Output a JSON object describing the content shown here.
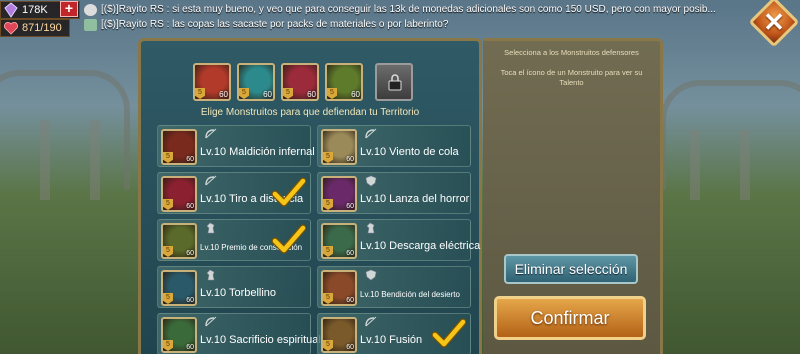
{
  "resources": {
    "gems": "178K",
    "health": "871/190",
    "add_label": "+"
  },
  "chat": [
    {
      "text": "[($)]Rayito RS : si esta muy bueno, y veo que para conseguir las 13k de monedas adicionales son como 150 USD, pero con mayor posib..."
    },
    {
      "text": "[($)]Rayito RS : las copas las sacaste por packs de materiales o por laberinto?"
    }
  ],
  "close_label": "✕",
  "panel": {
    "title": "Elige Monstruitos para que defiendan tu Territorio",
    "slots": [
      {
        "level": "60",
        "stars": "5",
        "color": "#b23a2a"
      },
      {
        "level": "60",
        "stars": "5",
        "color": "#2c8a8c"
      },
      {
        "level": "60",
        "stars": "5",
        "color": "#9b2b3a"
      },
      {
        "level": "60",
        "stars": "5",
        "color": "#5e7b2c"
      }
    ],
    "defenders": [
      {
        "name": "Lv.10 Maldición infernal",
        "level": "60",
        "stars": "5",
        "type": "bow",
        "color": "#7a2a1d",
        "selected": false,
        "small": false
      },
      {
        "name": "Lv.10 Viento de cola",
        "level": "60",
        "stars": "5",
        "type": "bow",
        "color": "#9a8a5a",
        "selected": false,
        "small": false
      },
      {
        "name": "Lv.10 Tiro a distancia",
        "level": "60",
        "stars": "5",
        "type": "bow",
        "color": "#8a2030",
        "selected": true,
        "small": false
      },
      {
        "name": "Lv.10 Lanza del horror",
        "level": "60",
        "stars": "5",
        "type": "shield",
        "color": "#6a2a6a",
        "selected": false,
        "small": false
      },
      {
        "name": "Lv.10 Premio de consolación",
        "level": "60",
        "stars": "5",
        "type": "horse",
        "color": "#5a6a2a",
        "selected": true,
        "small": true
      },
      {
        "name": "Lv.10 Descarga eléctrica",
        "level": "60",
        "stars": "5",
        "type": "horse",
        "color": "#3a6a4a",
        "selected": false,
        "small": false
      },
      {
        "name": "Lv.10 Torbellino",
        "level": "60",
        "stars": "5",
        "type": "horse",
        "color": "#2a5a6a",
        "selected": false,
        "small": false
      },
      {
        "name": "Lv.10 Bendición del desierto",
        "level": "60",
        "stars": "5",
        "type": "shield",
        "color": "#8a4a2a",
        "selected": false,
        "small": true
      },
      {
        "name": "Lv.10 Sacrificio espiritual",
        "level": "60",
        "stars": "5",
        "type": "bow",
        "color": "#3a6a3a",
        "selected": false,
        "small": false
      },
      {
        "name": "Lv.10 Fusión",
        "level": "60",
        "stars": "5",
        "type": "bow",
        "color": "#7a5a2a",
        "selected": true,
        "small": false
      }
    ]
  },
  "side": {
    "hint_title": "Selecciona a los Monstruitos defensores",
    "hint_body": "Toca el ícono de un Monstruito para ver su Talento",
    "clear_label": "Eliminar selección",
    "confirm_label": "Confirmar"
  }
}
